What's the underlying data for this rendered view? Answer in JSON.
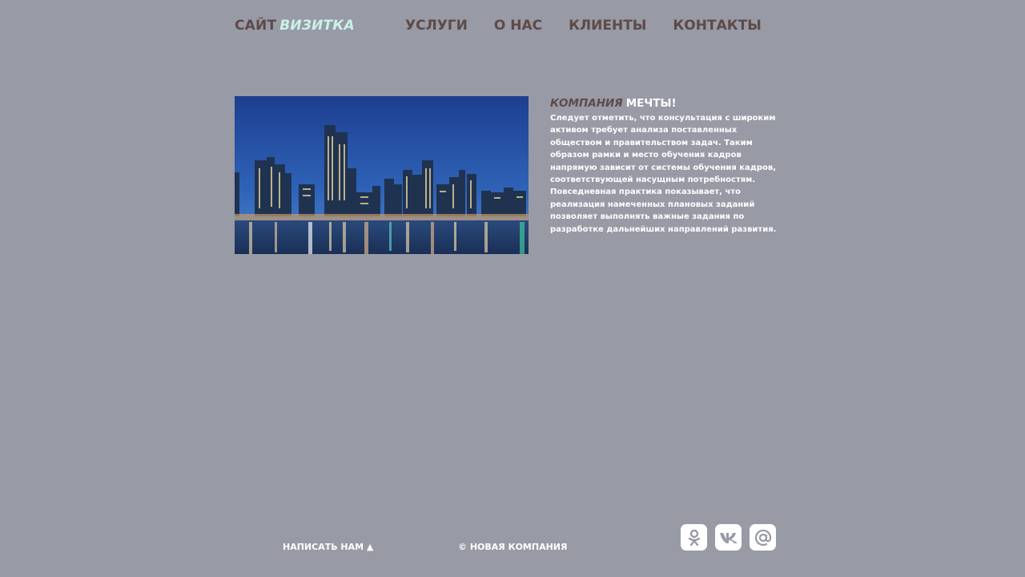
{
  "header": {
    "logo_part1": "САЙТ",
    "logo_part2": "ВИЗИТКА",
    "nav": [
      "УСЛУГИ",
      "О НАС",
      "КЛИЕНТЫ",
      "КОНТАКТЫ"
    ]
  },
  "article": {
    "heading_part1": "КОМПАНИЯ",
    "heading_part2": "МЕЧТЫ!",
    "body": "Следует отметить, что консультация с широким активом требует анализа поставленных обществом и правительством задач. Таким образом рамки и место обучения кадров напрямую зависит от системы обучения кадров, соответствующей насущным потребностям. Повседневная практика показывает, что реализация намеченных плановых заданий позволяет выполнять важные задания по разработке дальнейших направлений развития."
  },
  "footer": {
    "write_us": "НАПИСАТЬ НАМ ▲",
    "copyright": "© НОВАЯ КОМПАНИЯ",
    "social": [
      "odnoklassniki-icon",
      "vk-icon",
      "email-icon"
    ]
  },
  "colors": {
    "background": "#989aa6",
    "brown_text": "#5e4a47",
    "mint_accent": "#c9f2e6",
    "white": "#ffffff"
  }
}
